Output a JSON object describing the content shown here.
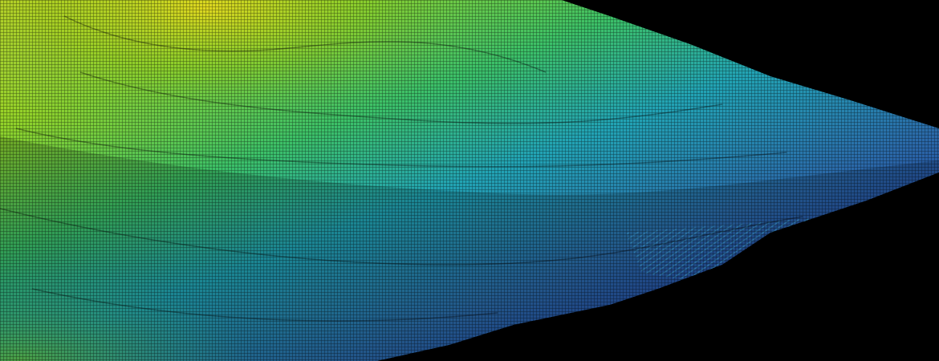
{
  "scene": {
    "kind": "terrain-wireframe-render",
    "background_color": "#000000",
    "colormap": [
      "#1a1f7a",
      "#2540a0",
      "#2a7ab0",
      "#22a6b8",
      "#2fbf8a",
      "#5ccc3c",
      "#a8d61e",
      "#d8d41a"
    ]
  }
}
